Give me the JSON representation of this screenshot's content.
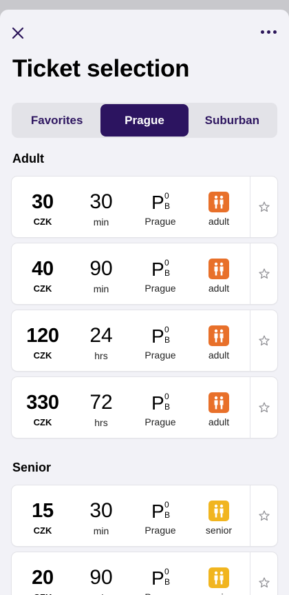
{
  "header": {
    "title": "Ticket selection",
    "close_icon": "close-icon",
    "more_icon": "more-horizontal-icon"
  },
  "tabs": [
    {
      "label": "Favorites",
      "active": false
    },
    {
      "label": "Prague",
      "active": true
    },
    {
      "label": "Suburban",
      "active": false
    }
  ],
  "colors": {
    "accent": "#2c1460",
    "adult_badge": "#e8702a",
    "senior_badge": "#f1b51f"
  },
  "sections": [
    {
      "title": "Adult",
      "tickets": [
        {
          "price": "30",
          "currency": "CZK",
          "duration": "30",
          "unit": "min",
          "zone_letter": "P",
          "zone_sup": "0",
          "zone_sub": "B",
          "zone": "Prague",
          "type": "adult",
          "badge_icon": "adult-persons-icon"
        },
        {
          "price": "40",
          "currency": "CZK",
          "duration": "90",
          "unit": "min",
          "zone_letter": "P",
          "zone_sup": "0",
          "zone_sub": "B",
          "zone": "Prague",
          "type": "adult",
          "badge_icon": "adult-persons-icon"
        },
        {
          "price": "120",
          "currency": "CZK",
          "duration": "24",
          "unit": "hrs",
          "zone_letter": "P",
          "zone_sup": "0",
          "zone_sub": "B",
          "zone": "Prague",
          "type": "adult",
          "badge_icon": "adult-persons-icon"
        },
        {
          "price": "330",
          "currency": "CZK",
          "duration": "72",
          "unit": "hrs",
          "zone_letter": "P",
          "zone_sup": "0",
          "zone_sub": "B",
          "zone": "Prague",
          "type": "adult",
          "badge_icon": "adult-persons-icon"
        }
      ]
    },
    {
      "title": "Senior",
      "tickets": [
        {
          "price": "15",
          "currency": "CZK",
          "duration": "30",
          "unit": "min",
          "zone_letter": "P",
          "zone_sup": "0",
          "zone_sub": "B",
          "zone": "Prague",
          "type": "senior",
          "badge_icon": "senior-persons-icon"
        },
        {
          "price": "20",
          "currency": "CZK",
          "duration": "90",
          "unit": "min",
          "zone_letter": "P",
          "zone_sup": "0",
          "zone_sub": "B",
          "zone": "Prague",
          "type": "senior",
          "badge_icon": "senior-persons-icon"
        }
      ]
    }
  ]
}
